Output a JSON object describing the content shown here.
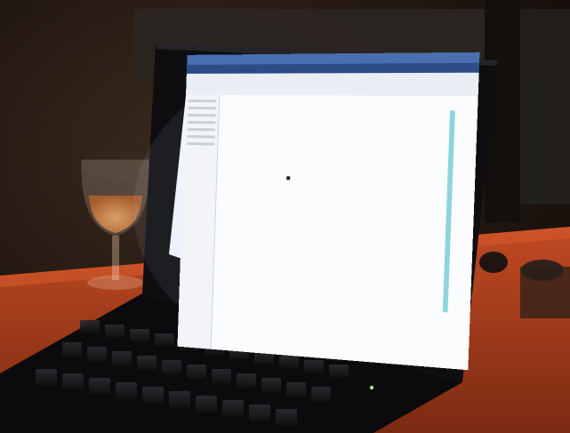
{
  "scene": {
    "description_type": "photo",
    "laptop_screen": {
      "menubar": {
        "items": [
          "",
          "",
          "",
          "",
          ""
        ],
        "clock": ""
      },
      "window_title": ""
    },
    "colors": {
      "table": "#b3411c",
      "screen_glow": "#e8eefc",
      "window_accent": "#2d4b86",
      "scroll_accent": "#8fd3e0"
    }
  }
}
